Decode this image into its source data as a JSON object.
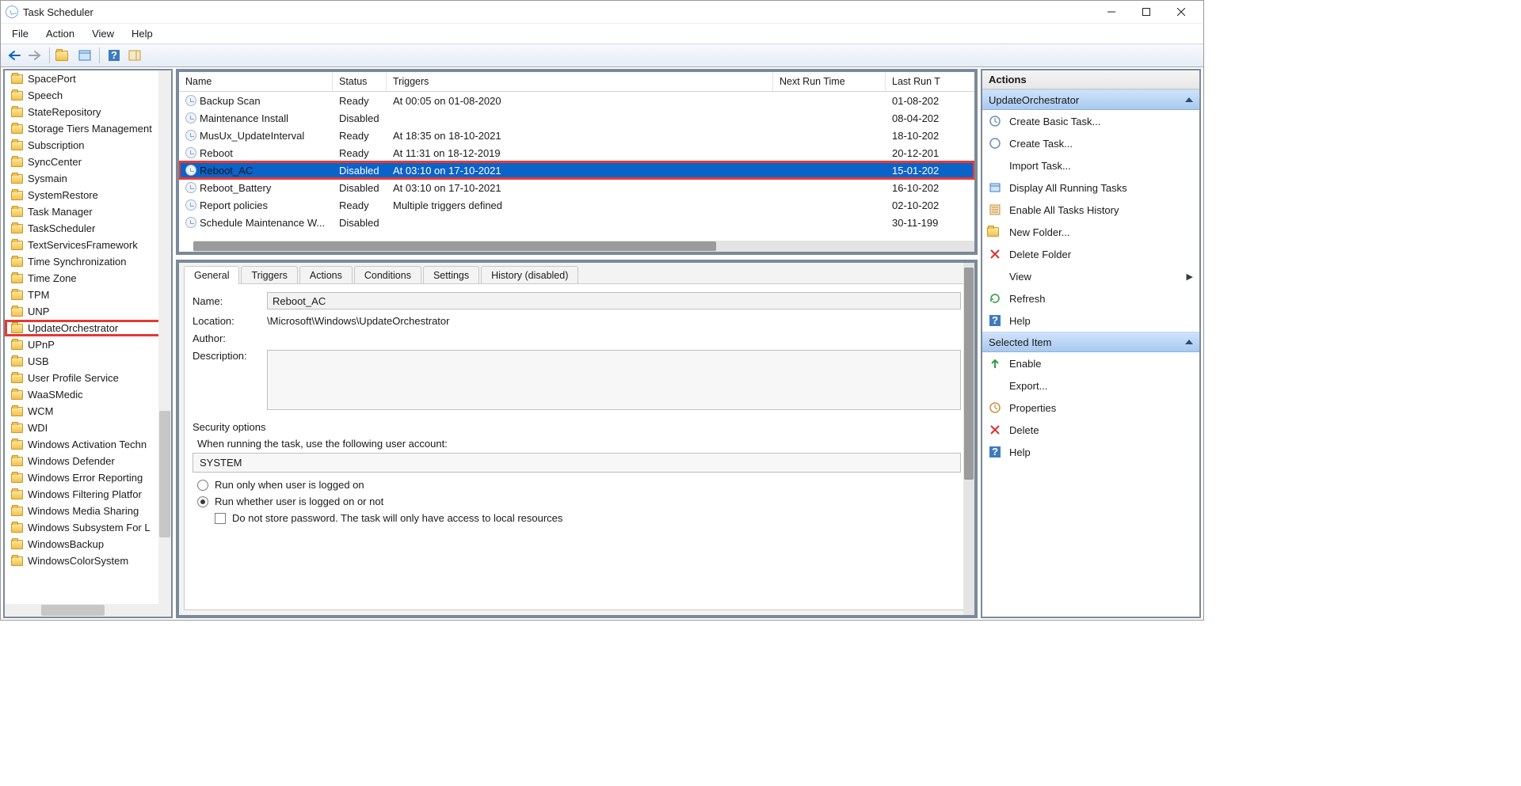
{
  "window": {
    "title": "Task Scheduler"
  },
  "menu": {
    "file": "File",
    "action": "Action",
    "view": "View",
    "help": "Help"
  },
  "tree": {
    "items": [
      "SpacePort",
      "Speech",
      "StateRepository",
      "Storage Tiers Management",
      "Subscription",
      "SyncCenter",
      "Sysmain",
      "SystemRestore",
      "Task Manager",
      "TaskScheduler",
      "TextServicesFramework",
      "Time Synchronization",
      "Time Zone",
      "TPM",
      "UNP",
      "UpdateOrchestrator",
      "UPnP",
      "USB",
      "User Profile Service",
      "WaaSMedic",
      "WCM",
      "WDI",
      "Windows Activation Techn",
      "Windows Defender",
      "Windows Error Reporting",
      "Windows Filtering Platfor",
      "Windows Media Sharing",
      "Windows Subsystem For L",
      "WindowsBackup",
      "WindowsColorSystem"
    ],
    "highlight_index": 15
  },
  "list": {
    "columns": {
      "name": "Name",
      "status": "Status",
      "triggers": "Triggers",
      "next": "Next Run Time",
      "last": "Last Run T"
    },
    "rows": [
      {
        "name": "Backup Scan",
        "status": "Ready",
        "triggers": "At 00:05 on 01-08-2020",
        "next": "",
        "last": "01-08-202"
      },
      {
        "name": "Maintenance Install",
        "status": "Disabled",
        "triggers": "",
        "next": "",
        "last": "08-04-202"
      },
      {
        "name": "MusUx_UpdateInterval",
        "status": "Ready",
        "triggers": "At 18:35 on 18-10-2021",
        "next": "",
        "last": "18-10-202"
      },
      {
        "name": "Reboot",
        "status": "Ready",
        "triggers": "At 11:31 on 18-12-2019",
        "next": "",
        "last": "20-12-201"
      },
      {
        "name": "Reboot_AC",
        "status": "Disabled",
        "triggers": "At 03:10 on 17-10-2021",
        "next": "",
        "last": "15-01-202"
      },
      {
        "name": "Reboot_Battery",
        "status": "Disabled",
        "triggers": "At 03:10 on 17-10-2021",
        "next": "",
        "last": "16-10-202"
      },
      {
        "name": "Report policies",
        "status": "Ready",
        "triggers": "Multiple triggers defined",
        "next": "",
        "last": "02-10-202"
      },
      {
        "name": "Schedule Maintenance W...",
        "status": "Disabled",
        "triggers": "",
        "next": "",
        "last": "30-11-199"
      }
    ],
    "selected_index": 4
  },
  "tabs": {
    "names": [
      "General",
      "Triggers",
      "Actions",
      "Conditions",
      "Settings",
      "History (disabled)"
    ],
    "active": 0
  },
  "detail": {
    "labels": {
      "name": "Name:",
      "location": "Location:",
      "author": "Author:",
      "description": "Description:"
    },
    "name": "Reboot_AC",
    "location": "\\Microsoft\\Windows\\UpdateOrchestrator",
    "author": "",
    "description": "",
    "security": {
      "heading": "Security options",
      "run_as_label": "When running the task, use the following user account:",
      "run_as": "SYSTEM",
      "opt_logged_on": "Run only when user is logged on",
      "opt_logged_off": "Run whether user is logged on or not",
      "opt_nostore": "Do not store password.  The task will only have access to local resources"
    }
  },
  "actions": {
    "title": "Actions",
    "group1": "UpdateOrchestrator",
    "group2": "Selected Item",
    "g1": [
      "Create Basic Task...",
      "Create Task...",
      "Import Task...",
      "Display All Running Tasks",
      "Enable All Tasks History",
      "New Folder...",
      "Delete Folder",
      "View",
      "Refresh",
      "Help"
    ],
    "g2": [
      "Enable",
      "Export...",
      "Properties",
      "Delete",
      "Help"
    ]
  }
}
